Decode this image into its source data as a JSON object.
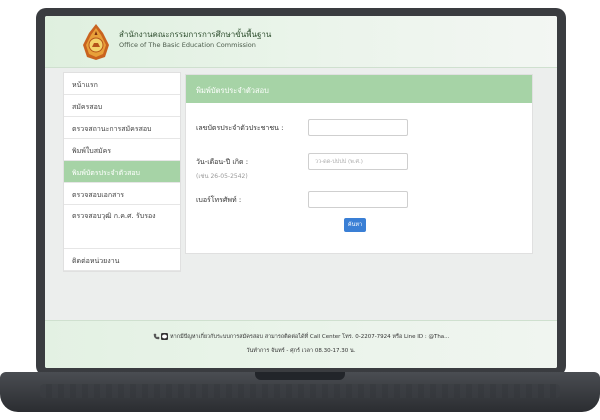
{
  "header": {
    "title_th": "สำนักงานคณะกรรมการการศึกษาขั้นพื้นฐาน",
    "title_en": "Office of The Basic Education Commission"
  },
  "sidebar": {
    "items": [
      {
        "label": "หน้าแรก"
      },
      {
        "label": "สมัครสอบ"
      },
      {
        "label": "ตรวจสถานะการสมัครสอบ"
      },
      {
        "label": "พิมพ์ใบสมัคร"
      },
      {
        "label": "พิมพ์บัตรประจำตัวสอบ",
        "active": true
      },
      {
        "label": "ตรวจสอบเอกสาร"
      },
      {
        "label": "ตรวจสอบวุฒิ ก.ค.ศ. รับรอง"
      },
      {
        "label": "ติดต่อหน่วยงาน"
      }
    ]
  },
  "panel": {
    "title": "พิมพ์บัตรประจำตัวสอบ",
    "id_label": "เลขบัตรประจำตัวประชาชน :",
    "dob_label": "วัน-เดือน-ปี เกิด :",
    "dob_hint": "(เช่น 26-05-2542)",
    "dob_placeholder": "วว-ดด-ปปปป (พ.ศ.)",
    "phone_label": "เบอร์โทรศัพท์ :",
    "submit_label": "ค้นหา"
  },
  "footer": {
    "line1": "หากมีปัญหาเกี่ยวกับระบบการสมัครสอบ สามารถติดต่อได้ที่ Call Center โทร. 0-2207-7924 หรือ Line ID : @Tha...",
    "line2": "วันทำการ จันทร์ - ศุกร์ เวลา 08.30-17.30 น."
  },
  "colors": {
    "accent": "#a6d3a6",
    "button": "#3a7fd5"
  }
}
